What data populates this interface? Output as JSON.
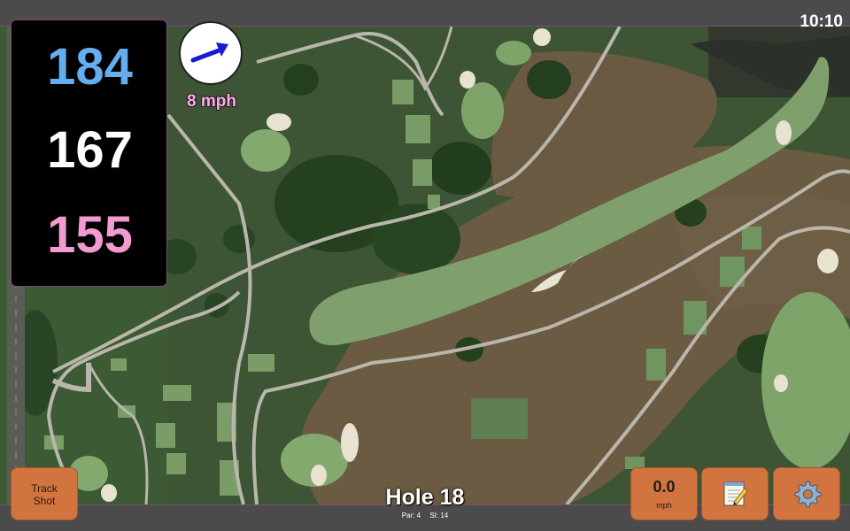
{
  "status": {
    "time": "10:10"
  },
  "distances": {
    "back": "184",
    "middle": "167",
    "front": "155"
  },
  "wind": {
    "speed": "8 mph",
    "direction_icon": "wind-arrow-icon"
  },
  "track_button": {
    "line1": "Track",
    "line2": "Shot"
  },
  "speed_button": {
    "value": "0.0",
    "unit": "mph"
  },
  "notes_button": {
    "icon": "notepad-icon"
  },
  "settings_button": {
    "icon": "gear-icon"
  },
  "hole": {
    "title": "Hole 18",
    "par": "Par: 4",
    "si": "SI: 14"
  },
  "colors": {
    "button": "#d2743f",
    "back": "#64aef0",
    "middle": "#ffffff",
    "front": "#f29bd0",
    "wind_text": "#f6b0e4",
    "arrow": "#1a1ad0"
  }
}
